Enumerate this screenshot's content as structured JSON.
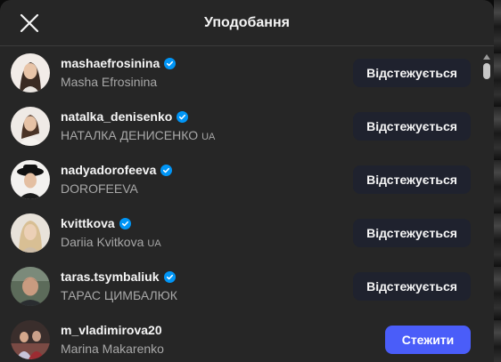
{
  "modal": {
    "title": "Уподобання",
    "close_icon": "close-icon"
  },
  "users": [
    {
      "username": "mashaefrosinina",
      "full_name": "Masha Efrosinina",
      "tag": "",
      "verified": true,
      "button": "Відстежується",
      "button_style": "following"
    },
    {
      "username": "natalka_denisenko",
      "full_name": "НАТАЛКА ДЕНИСЕНКО",
      "tag": "UA",
      "verified": true,
      "button": "Відстежується",
      "button_style": "following"
    },
    {
      "username": "nadyadorofeeva",
      "full_name": "DOROFEEVA",
      "tag": "",
      "verified": true,
      "button": "Відстежується",
      "button_style": "following"
    },
    {
      "username": "kvittkova",
      "full_name": "Dariia Kvitkova",
      "tag": "UA",
      "verified": true,
      "button": "Відстежується",
      "button_style": "following"
    },
    {
      "username": "taras.tsymbaliuk",
      "full_name": "ТАРАС ЦИМБАЛЮК",
      "tag": "",
      "verified": true,
      "button": "Відстежується",
      "button_style": "following"
    },
    {
      "username": "m_vladimirova20",
      "full_name": "Marina Makarenko",
      "tag": "",
      "verified": false,
      "button": "Стежити",
      "button_style": "follow"
    }
  ],
  "colors": {
    "modal_bg": "#262626",
    "following_btn_bg": "#1f222e",
    "follow_btn_bg": "#4a5df9",
    "verified_badge": "#0095f6",
    "secondary_text": "#a8a8a8"
  }
}
